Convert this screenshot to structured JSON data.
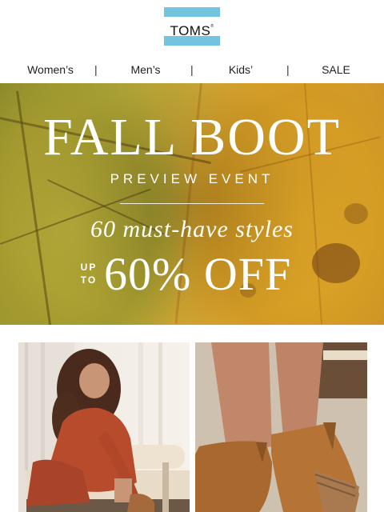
{
  "brand": {
    "logo_text": "TOMS",
    "registered": "®",
    "colors": {
      "logo_blue": "#5fb9d8",
      "hero_gold": "#dba42e",
      "hero_olive": "#a8a237"
    }
  },
  "nav": {
    "items": [
      "Women’s",
      "Men’s",
      "Kids’",
      "SALE"
    ],
    "separator": "|"
  },
  "hero": {
    "title": "FALL BOOT",
    "subtitle": "PREVIEW EVENT",
    "tagline": "60 must-have styles",
    "up": "UP",
    "to": "TO",
    "discount": "60% OFF"
  },
  "products": [
    {
      "icon": "woman-in-red-knit-dress-photo"
    },
    {
      "icon": "tan-suede-wedge-bootie-photo"
    }
  ]
}
